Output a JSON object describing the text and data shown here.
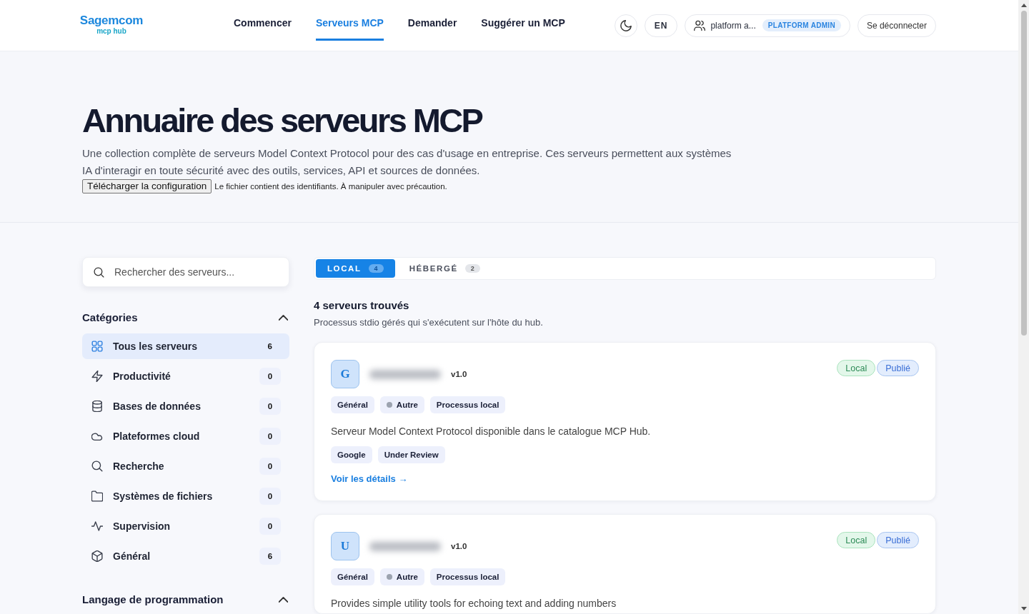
{
  "header": {
    "logo": {
      "brand": "Sagemcom",
      "sub": "mcp hub"
    },
    "nav": [
      {
        "label": "Commencer",
        "selected": false
      },
      {
        "label": "Serveurs MCP",
        "selected": true
      },
      {
        "label": "Demander",
        "selected": false
      },
      {
        "label": "Suggérer un MCP",
        "selected": false
      }
    ],
    "language": "EN",
    "user": {
      "name": "platform a...",
      "role": "PLATFORM ADMIN"
    },
    "logout": "Se déconnecter"
  },
  "hero": {
    "title": "Annuaire des serveurs MCP",
    "description": "Une collection complète de serveurs Model Context Protocol pour des cas d'usage en entreprise. Ces serveurs permettent aux systèmes IA d'interagir en toute sécurité avec des outils, services, API et sources de données.",
    "download_button": "Télécharger la configuration",
    "warning": "Le fichier contient des identifiants. À manipuler avec précaution."
  },
  "sidebar": {
    "search": {
      "placeholder": "Rechercher des serveurs..."
    },
    "sections": [
      {
        "title": "Catégories",
        "expanded": true,
        "items": [
          {
            "label": "Tous les serveurs",
            "count": "6",
            "kind": "grid",
            "selected": true
          },
          {
            "label": "Productivité",
            "count": "0",
            "kind": "bolt",
            "selected": false
          },
          {
            "label": "Bases de données",
            "count": "0",
            "kind": "database",
            "selected": false
          },
          {
            "label": "Plateformes cloud",
            "count": "0",
            "kind": "cloud",
            "selected": false
          },
          {
            "label": "Recherche",
            "count": "0",
            "kind": "search",
            "selected": false
          },
          {
            "label": "Systèmes de fichiers",
            "count": "0",
            "kind": "folder",
            "selected": false
          },
          {
            "label": "Supervision",
            "count": "0",
            "kind": "pulse",
            "selected": false
          },
          {
            "label": "Général",
            "count": "6",
            "kind": "cube",
            "selected": false
          }
        ]
      },
      {
        "title": "Langage de programmation",
        "expanded": true
      }
    ]
  },
  "tabs": [
    {
      "label": "LOCAL",
      "count": "4",
      "selected": true
    },
    {
      "label": "HÉBERGÉ",
      "count": "2",
      "selected": false
    }
  ],
  "results": {
    "title": "4 serveurs trouvés",
    "subtitle": "Processus stdio gérés qui s'exécutent sur l'hôte du hub."
  },
  "servers": [
    {
      "initial": "G",
      "version": "v1.0",
      "badges": [
        {
          "label": "Local",
          "kind": "mode"
        },
        {
          "label": "Publié",
          "kind": "status"
        }
      ],
      "tags": [
        {
          "label": "Général",
          "kind": "plain"
        },
        {
          "label": "Autre",
          "kind": "dot",
          "color": "#9ca3af"
        },
        {
          "label": "Processus local",
          "kind": "plain"
        }
      ],
      "description": "Serveur Model Context Protocol disponible dans le catalogue MCP Hub.",
      "labels": [
        "Google",
        "Under Review"
      ],
      "link": "Voir les détails →"
    },
    {
      "initial": "U",
      "version": "v1.0",
      "badges": [
        {
          "label": "Local",
          "kind": "mode"
        },
        {
          "label": "Publié",
          "kind": "status"
        }
      ],
      "tags": [
        {
          "label": "Général",
          "kind": "plain"
        },
        {
          "label": "Autre",
          "kind": "dot",
          "color": "#9ca3af"
        },
        {
          "label": "Processus local",
          "kind": "plain"
        }
      ],
      "description": "Provides simple utility tools for echoing text and adding numbers"
    }
  ]
}
